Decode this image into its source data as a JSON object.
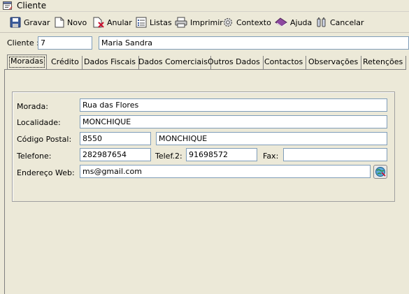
{
  "window": {
    "title": "Cliente"
  },
  "toolbar": {
    "gravar": "Gravar",
    "novo": "Novo",
    "anular": "Anular",
    "listas": "Listas",
    "imprimir": "Imprimir",
    "contexto": "Contexto",
    "ajuda": "Ajuda",
    "cancelar": "Cancelar"
  },
  "client": {
    "label": "Cliente :",
    "code": "7",
    "name": "Maria Sandra"
  },
  "tabs": [
    "Moradas",
    "Crédito",
    "Dados Fiscais",
    "Dados Comerciais",
    "Outros Dados",
    "Contactos",
    "Observações",
    "Retenções"
  ],
  "address": {
    "morada_label": "Morada:",
    "morada": "Rua das Flores",
    "localidade_label": "Localidade:",
    "localidade": "MONCHIQUE",
    "codigo_postal_label": "Código Postal:",
    "codigo_postal": "8550",
    "codigo_postal_local": "MONCHIQUE",
    "telefone_label": "Telefone:",
    "telefone": "282987654",
    "telef2_label": "Telef.2:",
    "telef2": "91698572",
    "fax_label": "Fax:",
    "fax": "",
    "web_label": "Endereço Web:",
    "web": "ms@gmail.com"
  },
  "colors": {
    "background": "#ece9d8",
    "field_border": "#7f9db9",
    "field_bg": "#ffffff"
  }
}
